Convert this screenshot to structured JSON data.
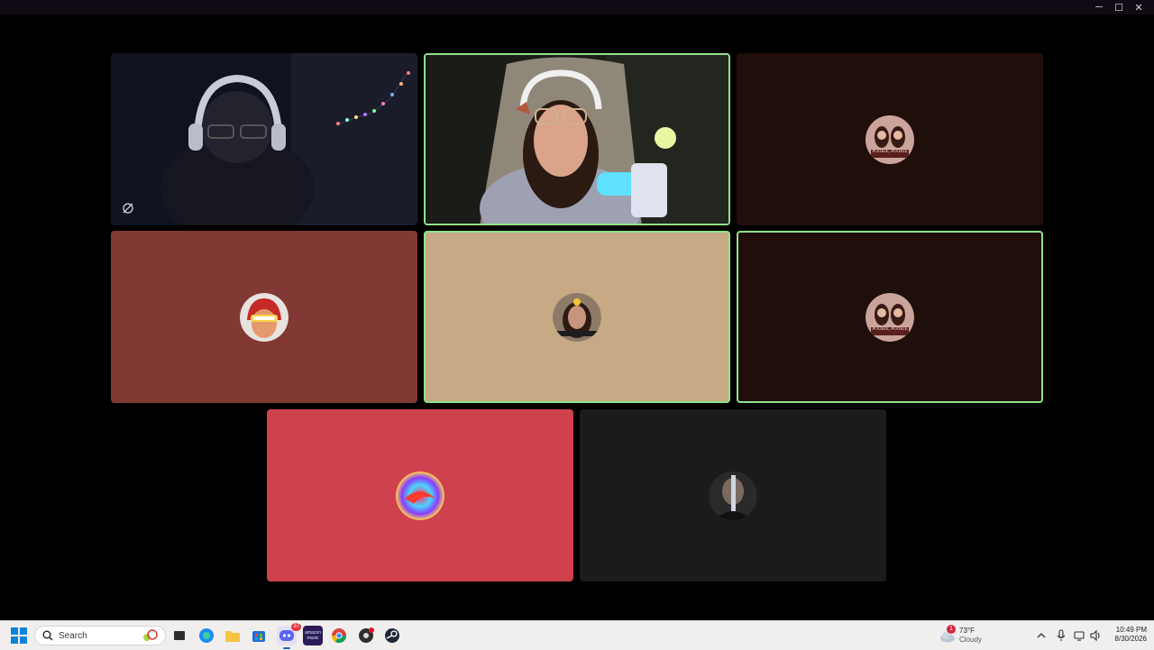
{
  "window": {
    "controls": {
      "minimize": "─",
      "maximize": "☐",
      "close": "✕"
    }
  },
  "participants": [
    {
      "name": "cam-participant-1",
      "type": "camera",
      "bg": "#141427"
    },
    {
      "name": "cam-participant-2",
      "type": "camera",
      "bg": "#2a2a24",
      "speaking": true
    },
    {
      "name": "avatar-participant-3",
      "type": "avatar",
      "bg": "#200e0b",
      "avatar_caption": "POOKIE, POOKIE"
    },
    {
      "name": "avatar-participant-4",
      "type": "avatar",
      "bg": "#823934"
    },
    {
      "name": "avatar-participant-5",
      "type": "avatar",
      "bg": "#c8a985",
      "speaking": true
    },
    {
      "name": "avatar-participant-6",
      "type": "avatar",
      "bg": "#200e0b",
      "speaking": true,
      "avatar_caption": "POOKIE, POOKIE"
    },
    {
      "name": "avatar-participant-7",
      "type": "avatar",
      "bg": "#d0414e"
    },
    {
      "name": "avatar-participant-8",
      "type": "avatar",
      "bg": "#1b1b1b"
    }
  ],
  "taskbar": {
    "search_placeholder": "Search",
    "discord_badge": "37",
    "weather_badge": "1",
    "temperature": "73°F",
    "condition": "Cloudy",
    "time": "10:49 PM",
    "date": "8/30/2026",
    "amazon_music_label": "amazon music"
  },
  "colors": {
    "speaking_border": "#8fe38a",
    "taskbar_bg": "#f1efee",
    "discord_accent": "#5865f2"
  }
}
